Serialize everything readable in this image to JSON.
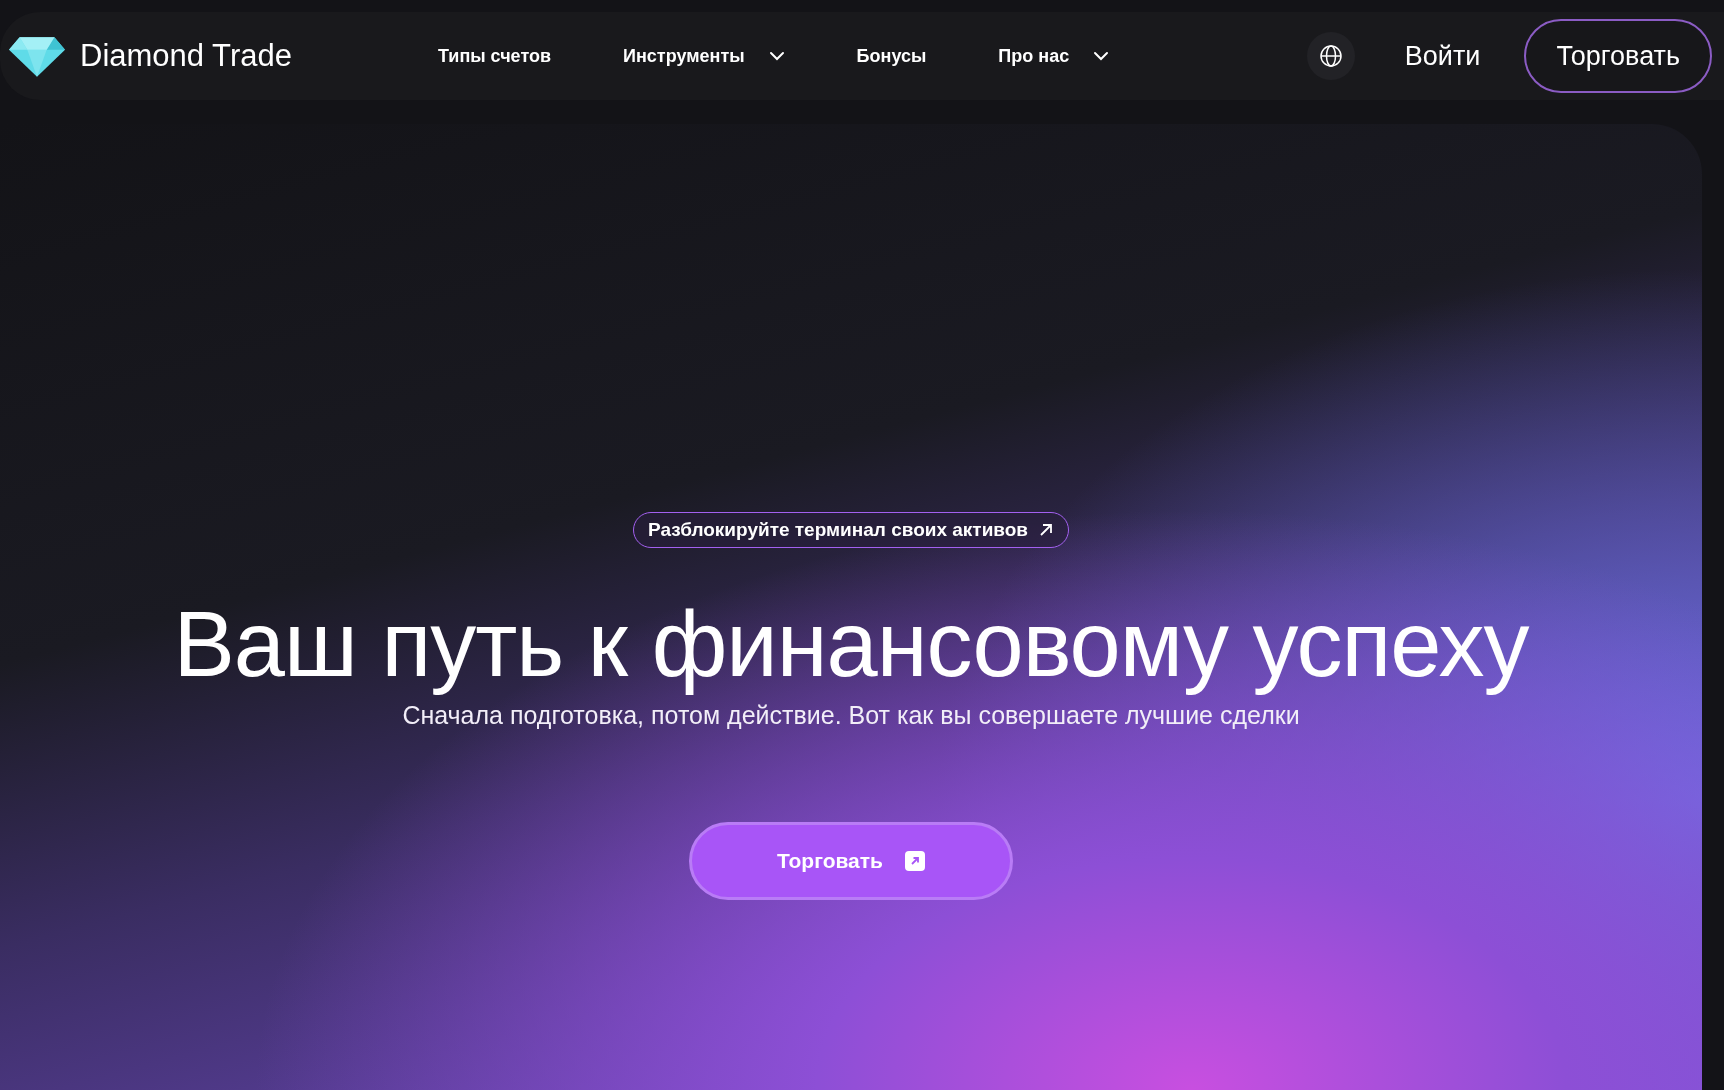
{
  "header": {
    "brand": "Diamond Trade",
    "nav": [
      {
        "label": "Типы счетов",
        "kind": "link"
      },
      {
        "label": "Инструменты",
        "kind": "dropdown"
      },
      {
        "label": "Бонусы",
        "kind": "link"
      },
      {
        "label": "Про нас",
        "kind": "dropdown"
      }
    ],
    "login": "Войти",
    "trade_button": "Торговать"
  },
  "hero": {
    "badge": "Разблокируйте терминал своих активов",
    "title": "Ваш путь к финансовому успеху",
    "subtitle": "Сначала подготовка, потом действие. Вот как вы совершаете лучшие сделки",
    "cta": "Торговать"
  }
}
